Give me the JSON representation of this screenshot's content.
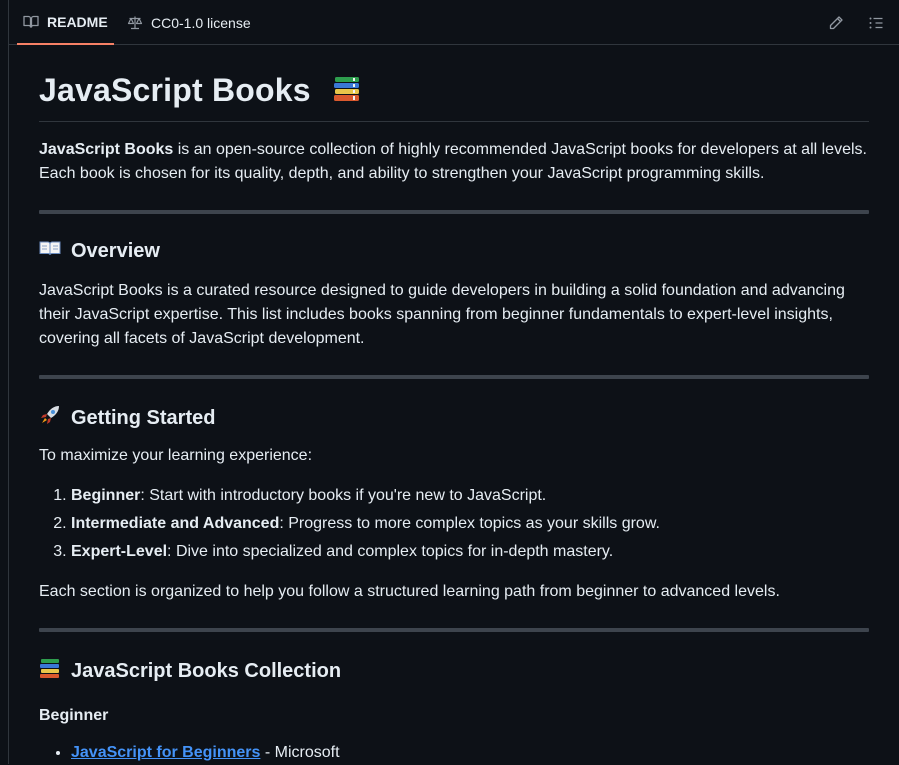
{
  "tabs": {
    "readme": "README",
    "license": "CC0-1.0 license"
  },
  "icons": {
    "readme": "book-icon",
    "license": "scale-icon",
    "edit": "pencil-icon",
    "outline": "list-icon"
  },
  "colors": {
    "background": "#0d1117",
    "text": "#e6edf3",
    "link": "#4493f8",
    "tab_active": "#f78166",
    "divider": "#3d444d"
  },
  "title": "JavaScript Books",
  "intro": {
    "bold": "JavaScript Books",
    "line1_rest": " is an open-source collection of highly recommended JavaScript books for developers at all levels.",
    "line2": "Each book is chosen for its quality, depth, and ability to strengthen your JavaScript programming skills."
  },
  "overview": {
    "heading": "Overview",
    "line1": "JavaScript Books is a curated resource designed to guide developers in building a solid foundation and advancing",
    "line2": "their JavaScript expertise. This list includes books spanning from beginner fundamentals to expert-level insights,",
    "line3": "covering all facets of JavaScript development."
  },
  "getting_started": {
    "heading": "Getting Started",
    "intro": "To maximize your learning experience:",
    "steps": [
      {
        "label": "Beginner",
        "text": ": Start with introductory books if you're new to JavaScript."
      },
      {
        "label": "Intermediate and Advanced",
        "text": ": Progress to more complex topics as your skills grow."
      },
      {
        "label": "Expert-Level",
        "text": ": Dive into specialized and complex topics for in-depth mastery."
      }
    ],
    "outro": "Each section is organized to help you follow a structured learning path from beginner to advanced levels."
  },
  "collection": {
    "heading": "JavaScript Books Collection",
    "subheading": "Beginner",
    "items": [
      {
        "title": "JavaScript for Beginners",
        "author": " - Microsoft"
      }
    ]
  }
}
